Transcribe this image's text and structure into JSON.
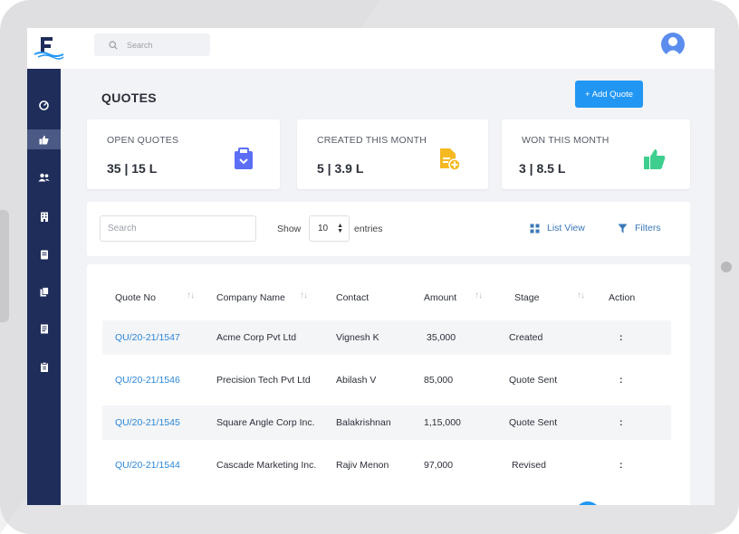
{
  "topbar": {
    "search_placeholder": "Search"
  },
  "page": {
    "title": "QUOTES",
    "add_button": "+ Add Quote"
  },
  "cards": [
    {
      "label": "OPEN QUOTES",
      "value": "35 | 15 L",
      "icon": "clipboard-icon",
      "color": "#5b6ef5"
    },
    {
      "label": "CREATED THIS MONTH",
      "value": "5 | 3.9 L",
      "icon": "file-add-icon",
      "color": "#f5b921"
    },
    {
      "label": "WON THIS MONTH",
      "value": "3 | 8.5 L",
      "icon": "thumbs-up-icon",
      "color": "#3ecf8e"
    }
  ],
  "filterbar": {
    "search_placeholder": "Search",
    "show_label": "Show",
    "entries_value": "10",
    "entries_label": "entries",
    "list_view": "List View",
    "filters": "Filters"
  },
  "table": {
    "columns": [
      "Quote No",
      "Company Name",
      "Contact",
      "Amount",
      "Stage",
      "Action"
    ],
    "rows": [
      {
        "quote_no": "QU/20-21/1547",
        "company": "Acme Corp Pvt Ltd",
        "contact": "Vignesh K",
        "amount": "35,000",
        "stage": "Created",
        "action": ":"
      },
      {
        "quote_no": "QU/20-21/1546",
        "company": "Precision Tech Pvt Ltd",
        "contact": "Abilash V",
        "amount": "85,000",
        "stage": "Quote Sent",
        "action": ":"
      },
      {
        "quote_no": "QU/20-21/1545",
        "company": "Square Angle Corp Inc.",
        "contact": "Balakrishnan",
        "amount": "1,15,000",
        "stage": "Quote Sent",
        "action": ":"
      },
      {
        "quote_no": "QU/20-21/1544",
        "company": "Cascade Marketing Inc.",
        "contact": "Rajiv Menon",
        "amount": "97,000",
        "stage": "Revised",
        "action": ":"
      }
    ]
  },
  "sidebar": {
    "items": [
      {
        "icon": "dashboard-icon",
        "active": false
      },
      {
        "icon": "thumbs-up-icon",
        "active": true
      },
      {
        "icon": "users-icon",
        "active": false
      },
      {
        "icon": "building-icon",
        "active": false
      },
      {
        "icon": "book-icon",
        "active": false
      },
      {
        "icon": "copy-icon",
        "active": false
      },
      {
        "icon": "document-icon",
        "active": false
      },
      {
        "icon": "clipboard-icon",
        "active": false
      }
    ]
  },
  "colors": {
    "sidebar": "#1f2d5a",
    "primary": "#2196f3",
    "link": "#2a86d6"
  }
}
